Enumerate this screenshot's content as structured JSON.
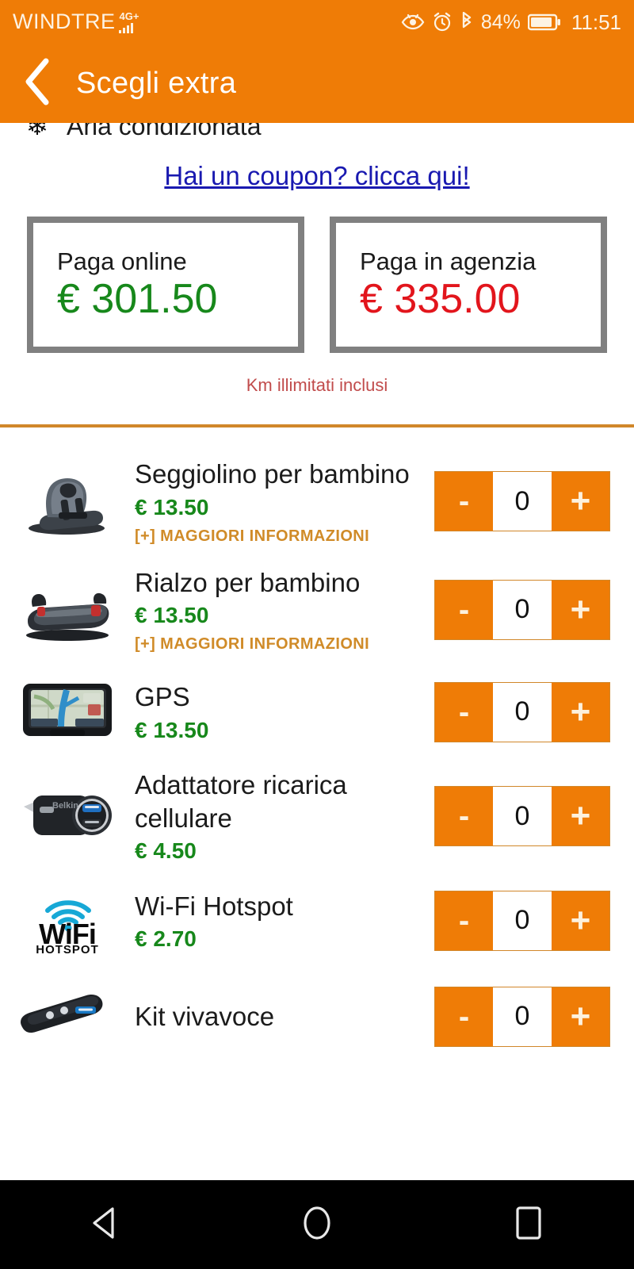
{
  "status_bar": {
    "carrier": "WINDTRE",
    "network": "4G+",
    "battery_percent": "84%",
    "time": "11:51",
    "icons": [
      "eye-comfort-icon",
      "alarm-clock-icon",
      "bluetooth-icon",
      "battery-icon",
      "signal-bars-icon"
    ]
  },
  "app_bar": {
    "back_icon": "chevron-left-icon",
    "title": "Scegli extra"
  },
  "summary": {
    "aria_icon": "snowflake-icon",
    "aria_label": "Aria condizionata",
    "coupon_link": "Hai un coupon? clicca qui!",
    "pay_online": {
      "label": "Paga online",
      "amount": "€ 301.50",
      "color": "#17881b"
    },
    "pay_agency": {
      "label": "Paga in agenzia",
      "amount": "€ 335.00",
      "color": "#e2151c"
    },
    "km_note": "Km illimitati inclusi",
    "divider_color": "#d1872a"
  },
  "stepper": {
    "minus_label": "-",
    "plus_label": "+",
    "more_info_label": "[+] MAGGIORI INFORMAZIONI"
  },
  "extras": [
    {
      "icon": "child-car-seat-icon",
      "name": "Seggiolino per bambino",
      "price": "€ 13.50",
      "qty": "0",
      "has_more_info": true
    },
    {
      "icon": "booster-seat-icon",
      "name": "Rialzo per bambino",
      "price": "€ 13.50",
      "qty": "0",
      "has_more_info": true
    },
    {
      "icon": "gps-device-icon",
      "name": "GPS",
      "price": "€ 13.50",
      "qty": "0",
      "has_more_info": false
    },
    {
      "icon": "car-charger-icon",
      "name": "Adattatore ricarica cellulare",
      "price": "€ 4.50",
      "qty": "0",
      "has_more_info": false
    },
    {
      "icon": "wifi-hotspot-icon",
      "name": "Wi-Fi Hotspot",
      "price": "€ 2.70",
      "qty": "0",
      "has_more_info": false
    },
    {
      "icon": "handsfree-kit-icon",
      "name": "Kit vivavoce",
      "price": "",
      "qty": "0",
      "has_more_info": false
    }
  ],
  "nav_bar": {
    "back": "triangle-back-icon",
    "home": "circle-home-icon",
    "recents": "square-recents-icon"
  },
  "theme": {
    "accent_orange": "#ef7c06",
    "link_blue": "#1919b0",
    "price_green": "#17881b",
    "price_red": "#e2151c",
    "gold": "#d08b28",
    "box_border_gray": "#808080"
  }
}
